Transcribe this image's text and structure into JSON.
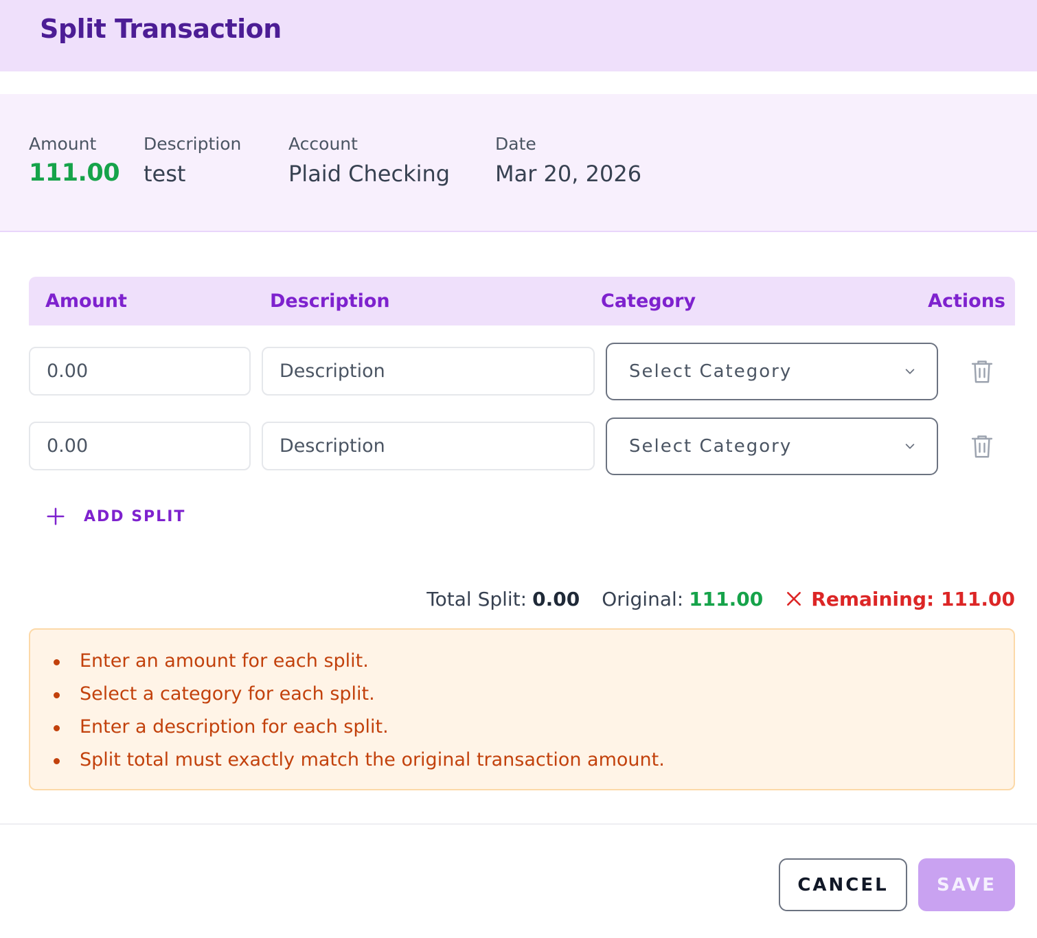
{
  "dialog": {
    "title": "Split Transaction"
  },
  "summary": {
    "amount_label": "Amount",
    "amount_value": "111.00",
    "description_label": "Description",
    "description_value": "test",
    "account_label": "Account",
    "account_value": "Plaid Checking",
    "date_label": "Date",
    "date_value": "Mar 20, 2026"
  },
  "table": {
    "headers": {
      "amount": "Amount",
      "description": "Description",
      "category": "Category",
      "actions": "Actions"
    },
    "rows": [
      {
        "amount_placeholder": "0.00",
        "description_placeholder": "Description",
        "category_label": "Select Category"
      },
      {
        "amount_placeholder": "0.00",
        "description_placeholder": "Description",
        "category_label": "Select Category"
      }
    ]
  },
  "add_split": {
    "label": "ADD SPLIT"
  },
  "totals": {
    "total_split_label": "Total Split:",
    "total_split_value": "0.00",
    "original_label": "Original:",
    "original_value": "111.00",
    "remaining_text": "Remaining: 111.00"
  },
  "errors": [
    "Enter an amount for each split.",
    "Select a category for each split.",
    "Enter a description for each split.",
    "Split total must exactly match the original transaction amount."
  ],
  "footer": {
    "cancel_label": "CANCEL",
    "save_label": "SAVE"
  },
  "icons": {
    "add": "plus-icon",
    "delete": "trash-icon",
    "dropdown": "chevron-down-icon",
    "status": "close-icon"
  },
  "colors": {
    "header_bg": "#efe0fb",
    "title": "#4c1d95",
    "accent": "#7e22ce",
    "positive": "#16a34a",
    "error": "#dc2626",
    "warning_text": "#c2410c",
    "warning_bg": "#fff4e7",
    "save_disabled": "#c9a2f1"
  }
}
